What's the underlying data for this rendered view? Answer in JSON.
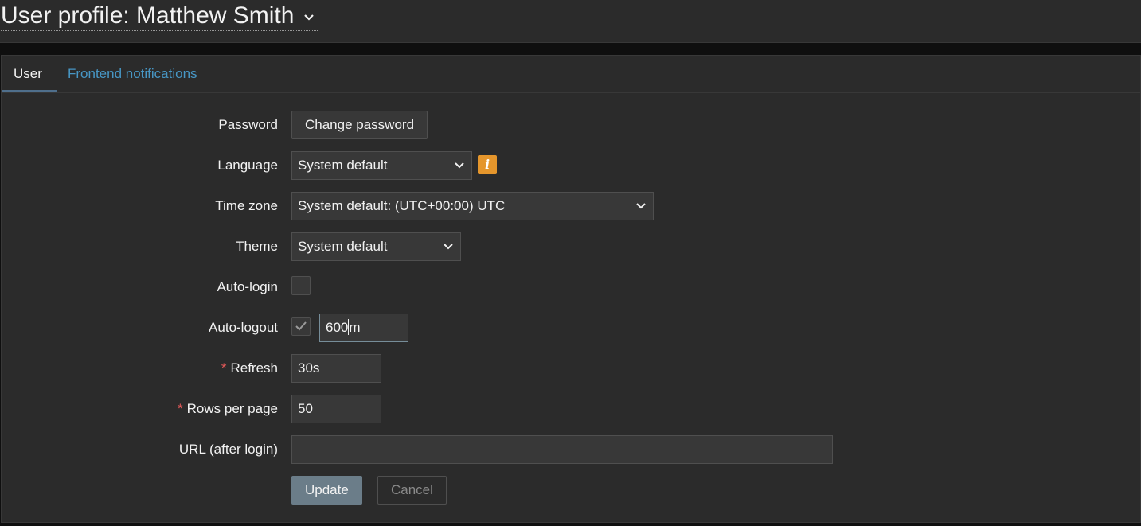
{
  "header": {
    "title": "User profile: Matthew Smith"
  },
  "tabs": [
    {
      "label": "User",
      "active": true
    },
    {
      "label": "Frontend notifications",
      "active": false
    }
  ],
  "form": {
    "password": {
      "label": "Password",
      "button": "Change password"
    },
    "language": {
      "label": "Language",
      "value": "System default",
      "info_icon": "info-icon"
    },
    "timezone": {
      "label": "Time zone",
      "value": "System default: (UTC+00:00) UTC"
    },
    "theme": {
      "label": "Theme",
      "value": "System default"
    },
    "autologin": {
      "label": "Auto-login",
      "checked": false
    },
    "autologout": {
      "label": "Auto-logout",
      "checked": true,
      "value_before_caret": "600",
      "value_after_caret": "m"
    },
    "refresh": {
      "label": "Refresh",
      "required_mark": "*",
      "value": "30s"
    },
    "rows_per_page": {
      "label": "Rows per page",
      "required_mark": "*",
      "value": "50"
    },
    "url": {
      "label": "URL (after login)",
      "value": ""
    }
  },
  "actions": {
    "update": "Update",
    "cancel": "Cancel"
  },
  "colors": {
    "background": "#2b2b2b",
    "link": "#4796c4",
    "info": "#e5962c",
    "required": "#e45959",
    "primary_button": "#6b7d89"
  }
}
